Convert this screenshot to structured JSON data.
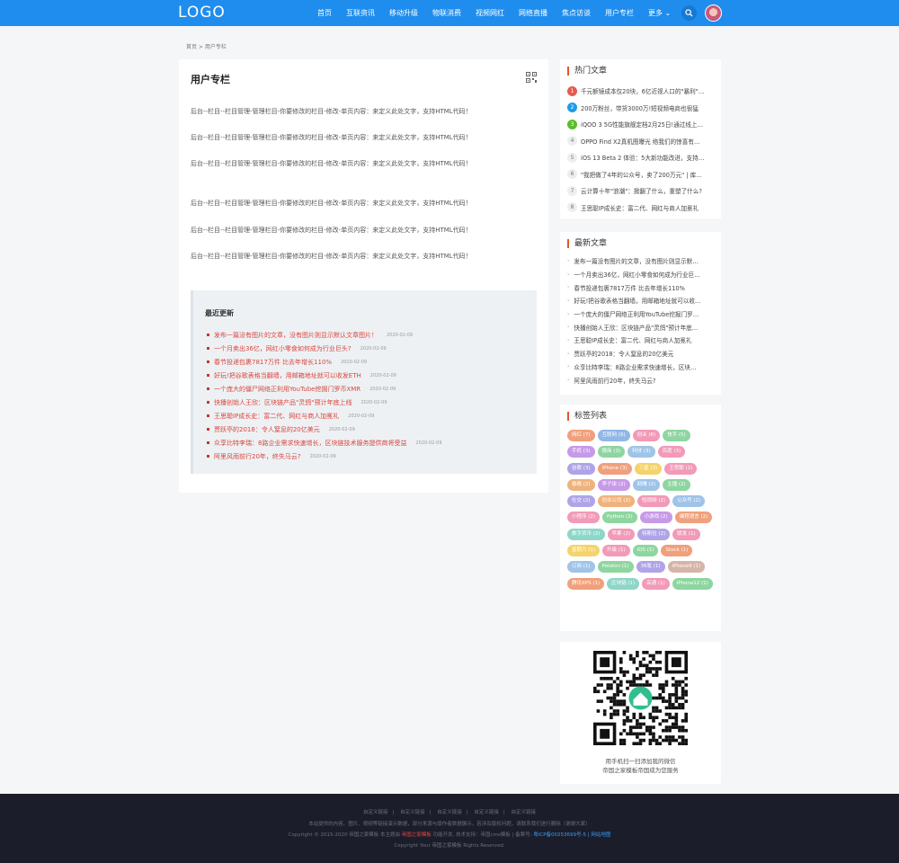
{
  "header": {
    "logo": "LOGO",
    "nav": [
      "首页",
      "互联资讯",
      "移动升级",
      "物联消费",
      "视频网红",
      "网络直播",
      "焦点访谈",
      "用户专栏"
    ],
    "more": "更多 ⌄"
  },
  "breadcrumb": "首页 > 用户专栏",
  "main": {
    "title": "用户专栏",
    "paragraphs": [
      "后台--栏目--栏目管理-管理栏目-你要修改的栏目-修改-单页内容：来定义此处文字，支持HTML代码！",
      "后台--栏目--栏目管理-管理栏目-你要修改的栏目-修改-单页内容：来定义此处文字，支持HTML代码！",
      "后台--栏目--栏目管理-管理栏目-你要修改的栏目-修改-单页内容：来定义此处文字，支持HTML代码！",
      "后台--栏目--栏目管理-管理栏目-你要修改的栏目-修改-单页内容：来定义此处文字，支持HTML代码！",
      "后台--栏目--栏目管理-管理栏目-你要修改的栏目-修改-单页内容：来定义此处文字，支持HTML代码！",
      "后台--栏目--栏目管理-管理栏目-你要修改的栏目-修改-单页内容：来定义此处文字，支持HTML代码！"
    ],
    "recent_title": "最近更新",
    "recent": [
      {
        "title": "发布一篇没有图片的文章，没有图片则显示默认文章图片！",
        "date": "2020-02-09"
      },
      {
        "title": "一个月卖出36亿，网红小零食如何成为行业巨头?",
        "date": "2020-02-09"
      },
      {
        "title": "春节投递包裹7817万件 比去年增长110%",
        "date": "2020-02-09"
      },
      {
        "title": "好玩!把谷歌表格当翻墙，用邮箱地址就可以收发ETH",
        "date": "2020-02-09"
      },
      {
        "title": "一个庞大的僵尸网络正利用YouTube挖掘门罗币XMR",
        "date": "2020-02-09"
      },
      {
        "title": "快播创始人王欣：区块链产品\"灵鸽\"预计年底上线",
        "date": "2020-02-09"
      },
      {
        "title": "王思聪IP成长史：富二代、网红与商人加冕礼",
        "date": "2020-02-09"
      },
      {
        "title": "贾跃亭的2018：令人窒息的20亿美元",
        "date": "2020-02-09"
      },
      {
        "title": "众享比特李瑞：8路企业需求快速增长，区块链技术服务提供商将受益",
        "date": "2020-02-09"
      },
      {
        "title": "阿里风雨前行20年，终失马云?",
        "date": "2020-02-09"
      }
    ]
  },
  "hot": {
    "title": "热门文章",
    "items": [
      {
        "num": "1",
        "title": "千元额镜成本仅20块，6亿近视人口的\"暴利\"…"
      },
      {
        "num": "2",
        "title": "200万粉丝，带货3000万!短视频电商也很猛"
      },
      {
        "num": "3",
        "title": "iQOO 3 5G性能旗舰定档2月25日!通过线上…"
      },
      {
        "num": "4",
        "title": "OPPO Find X2真机图曝光 络我们的惊喜有…"
      },
      {
        "num": "5",
        "title": "iOS 13 Beta 2 体验：5大新功能改进，支持…"
      },
      {
        "num": "6",
        "title": "\"我把做了4年的公众号，卖了200万元\" | 库…"
      },
      {
        "num": "7",
        "title": "云计算十年\"浪潮\"：掀翻了什么，重塑了什么?"
      },
      {
        "num": "8",
        "title": "王思聪IP成长史：富二代、网红与商人加冕礼"
      }
    ]
  },
  "latest": {
    "title": "最新文章",
    "items": [
      "发布一篇没有图片的文章，没有图片则显示默…",
      "一个月卖出36亿，网红小零食如何成为行业巨…",
      "春节投递包裹7817万件 比去年增长110%",
      "好玩!把谷歌表格当翻墙，用邮箱地址就可以收…",
      "一个庞大的僵尸网络正利用YouTube挖掘门罗…",
      "快播创始人王欣：区块链产品\"灵鸽\"预计年底…",
      "王思聪IP成长史：富二代、网红与商人加冕礼",
      "贾跃亭的2018：令人窒息的20亿美元",
      "众享比特李瑞：8路企业需求快速增长，区块…",
      "阿里风雨前行20年，终失马云?"
    ]
  },
  "tags": {
    "title": "标签列表",
    "items": [
      {
        "label": "网红 (7)",
        "color": "#f0a07c"
      },
      {
        "label": "互联网 (6)",
        "color": "#8fb7e8"
      },
      {
        "label": "创业 (6)",
        "color": "#f29ab8"
      },
      {
        "label": "快手 (5)",
        "color": "#8ed6a0"
      },
      {
        "label": "手机 (3)",
        "color": "#c79ae8"
      },
      {
        "label": "微商 (3)",
        "color": "#8ed6a0"
      },
      {
        "label": "科技 (3)",
        "color": "#9fc4e8"
      },
      {
        "label": "百度 (3)",
        "color": "#f29ab8"
      },
      {
        "label": "谷歌 (3)",
        "color": "#b0a4e8"
      },
      {
        "label": "iPhone (3)",
        "color": "#f0a07c"
      },
      {
        "label": "三星 (3)",
        "color": "#f5d36b"
      },
      {
        "label": "王思聪 (2)",
        "color": "#f29ab8"
      },
      {
        "label": "春晚 (2)",
        "color": "#f0b27c"
      },
      {
        "label": "李子柒 (2)",
        "color": "#c79ae8"
      },
      {
        "label": "网赚 (2)",
        "color": "#9fc4e8"
      },
      {
        "label": "主播 (2)",
        "color": "#8ed6a0"
      },
      {
        "label": "社交 (2)",
        "color": "#b0a4e8"
      },
      {
        "label": "创业公司 (2)",
        "color": "#f0b27c"
      },
      {
        "label": "短视频 (2)",
        "color": "#f29ab8"
      },
      {
        "label": "公众号 (2)",
        "color": "#9fc4e8"
      },
      {
        "label": "小程序 (2)",
        "color": "#f29ab8"
      },
      {
        "label": "Python (2)",
        "color": "#8ed6a0"
      },
      {
        "label": "小游戏 (2)",
        "color": "#c79ae8"
      },
      {
        "label": "编程语言 (2)",
        "color": "#f0a07c"
      },
      {
        "label": "数字货币 (2)",
        "color": "#8ed6c8"
      },
      {
        "label": "苹果 (2)",
        "color": "#f29ab8"
      },
      {
        "label": "特斯拉 (2)",
        "color": "#b0a4e8"
      },
      {
        "label": "联发 (1)",
        "color": "#f29ab8"
      },
      {
        "label": "星期六 (1)",
        "color": "#f5d36b"
      },
      {
        "label": "升级 (1)",
        "color": "#f29ab8"
      },
      {
        "label": "iOS (1)",
        "color": "#8ed6a0"
      },
      {
        "label": "Stock (1)",
        "color": "#f0a07c"
      },
      {
        "label": "订阅 (1)",
        "color": "#9fc4e8"
      },
      {
        "label": "Peloton (1)",
        "color": "#8ed6a0"
      },
      {
        "label": "36氪 (1)",
        "color": "#b0a4e8"
      },
      {
        "label": "iPhone9 (1)",
        "color": "#d6b4a8"
      },
      {
        "label": "腾讯XPS (1)",
        "color": "#f0a07c"
      },
      {
        "label": "区块链 (1)",
        "color": "#8ed6c8"
      },
      {
        "label": "高通 (1)",
        "color": "#f29ab8"
      },
      {
        "label": "iPhone12 (1)",
        "color": "#8ed6a0"
      }
    ]
  },
  "qr": {
    "caption1": "用手机扫一扫添加我的微信",
    "caption2": "帝国之家模板帝国成为您服务"
  },
  "footer": {
    "links": [
      "自定义链接",
      "自定义链接",
      "自定义链接",
      "自定义链接",
      "自定义链接"
    ],
    "line1": "本站提供的内容、图片、视频等链接演示数据，部分来源与版作者数据展示，若涉及版权问题，请联系我们进行删除（谢谢大家）",
    "line2_a": "Copyright © 2015-2020 帝国之家模板 本主题由",
    "line2_red": "帝国之家模板",
    "line2_b": "功能开发, 技术支持：帝国cms模板 | 备案号:",
    "line2_blue": "粤ICP备00253699号-5 | 网站地图",
    "line3": "Copyright Your 帝国之家模板 Rights Reserved."
  }
}
